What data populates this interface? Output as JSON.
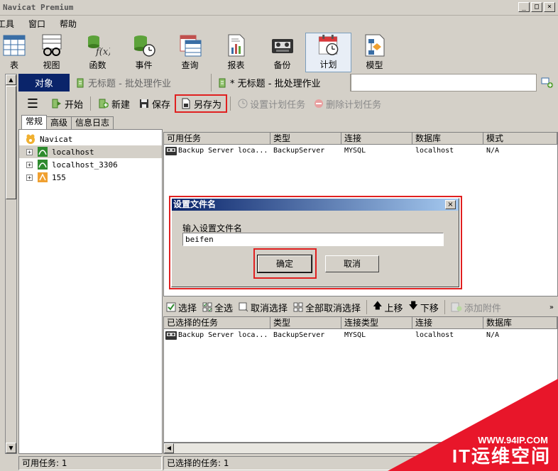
{
  "window": {
    "title": "Navicat Premium",
    "buttons": [
      "_",
      "□",
      "×"
    ]
  },
  "menu": [
    "工具",
    "窗口",
    "帮助"
  ],
  "toolbar": [
    "表",
    "视图",
    "函数",
    "事件",
    "查询",
    "报表",
    "备份",
    "计划",
    "模型"
  ],
  "tabs": {
    "object_tab": "对象",
    "doc_tab_1": "无标题 - 批处理作业",
    "doc_tab_2": "* 无标题 - 批处理作业"
  },
  "actions": {
    "start": "开始",
    "new": "新建",
    "save": "保存",
    "save_as": "另存为",
    "set_schedule": "设置计划任务",
    "delete_schedule": "删除计划任务"
  },
  "subtabs": [
    "常规",
    "高级",
    "信息日志"
  ],
  "tree": {
    "root": "Navicat",
    "connections": [
      "localhost",
      "localhost_3306",
      "155"
    ]
  },
  "available": {
    "headers": [
      "可用任务",
      "类型",
      "连接",
      "数据库",
      "模式"
    ],
    "rows": [
      [
        "Backup Server loca...",
        "BackupServer",
        "MYSQL",
        "localhost",
        "N/A"
      ]
    ]
  },
  "dialog": {
    "title": "设置文件名",
    "close": "×",
    "label": "输入设置文件名",
    "value": "beifen",
    "ok": "确定",
    "cancel": "取消"
  },
  "midbar": {
    "select": "选择",
    "select_all": "全选",
    "deselect": "取消选择",
    "deselect_all": "全部取消选择",
    "move_up": "上移",
    "move_down": "下移",
    "add_attachment": "添加附件"
  },
  "selected": {
    "headers": [
      "已选择的任务",
      "类型",
      "连接类型",
      "连接",
      "数据库"
    ],
    "rows": [
      [
        "Backup Server loca...",
        "BackupServer",
        "MYSQL",
        "localhost",
        "N/A"
      ]
    ]
  },
  "status": {
    "available": "可用任务: 1",
    "selected": "已选择的任务: 1"
  },
  "watermark": {
    "url": "WWW.94IP.COM",
    "brand": "IT运维空间"
  },
  "colors": {
    "accent": "#0a246a",
    "highlight": "#e02020",
    "watermark": "#e8162a"
  }
}
